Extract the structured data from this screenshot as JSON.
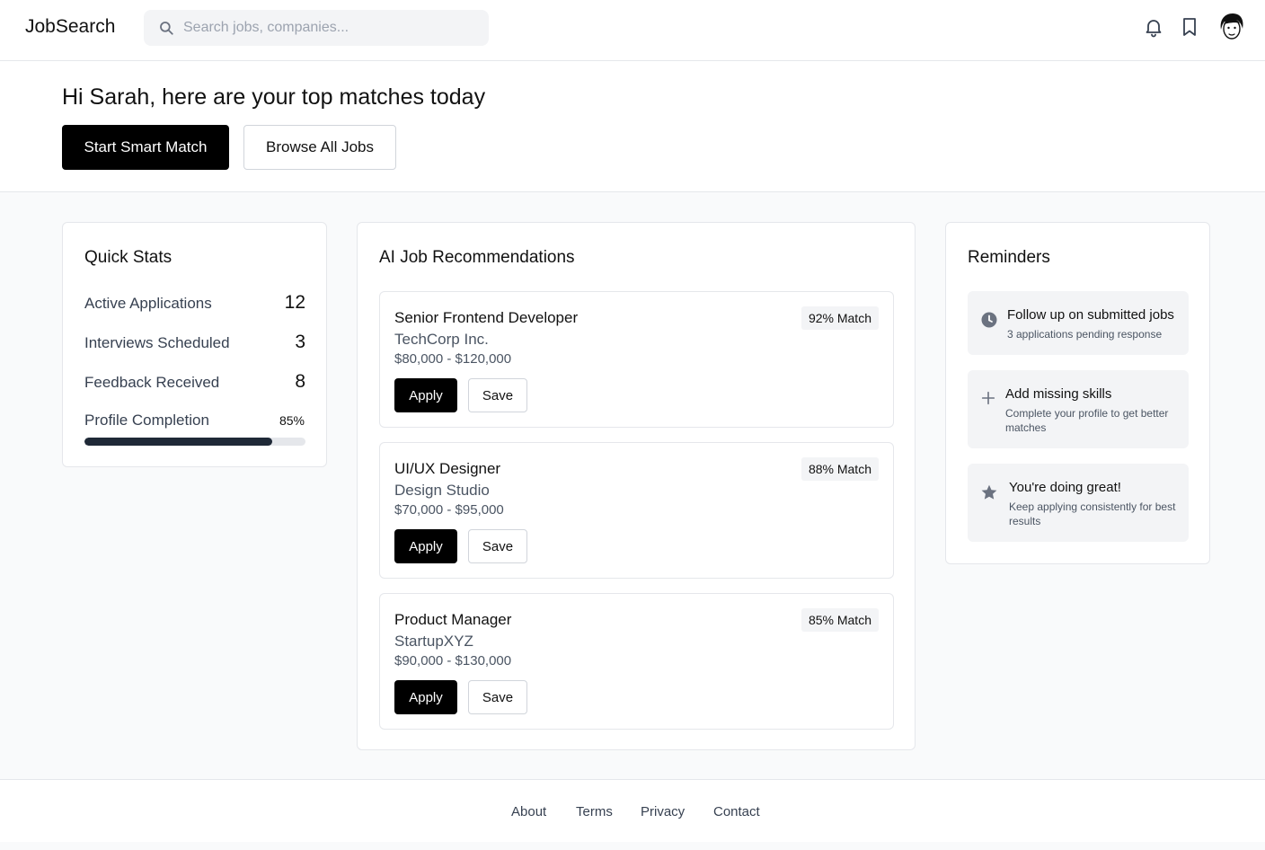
{
  "header": {
    "logo": "JobSearch",
    "search_placeholder": "Search jobs, companies...",
    "icons": [
      "bell-icon",
      "bookmark-icon"
    ]
  },
  "hero": {
    "greeting": "Hi Sarah, here are your top matches today",
    "primary_button": "Start Smart Match",
    "secondary_button": "Browse All Jobs"
  },
  "quick_stats": {
    "title": "Quick Stats",
    "items": [
      {
        "label": "Active Applications",
        "value": "12"
      },
      {
        "label": "Interviews Scheduled",
        "value": "3"
      },
      {
        "label": "Feedback Received",
        "value": "8"
      }
    ],
    "profile_completion_label": "Profile Completion",
    "profile_completion_text": "85%",
    "profile_completion_value": 0.85
  },
  "recommendations": {
    "title": "AI Job Recommendations",
    "apply_label": "Apply",
    "save_label": "Save",
    "jobs": [
      {
        "title": "Senior Frontend Developer",
        "company": "TechCorp Inc.",
        "salary": "$80,000 - $120,000",
        "match": "92% Match"
      },
      {
        "title": "UI/UX Designer",
        "company": "Design Studio",
        "salary": "$70,000 - $95,000",
        "match": "88% Match"
      },
      {
        "title": "Product Manager",
        "company": "StartupXYZ",
        "salary": "$90,000 - $130,000",
        "match": "85% Match"
      }
    ]
  },
  "reminders": {
    "title": "Reminders",
    "items": [
      {
        "icon": "clock-icon",
        "title": "Follow up on submitted jobs",
        "subtitle": "3 applications pending response"
      },
      {
        "icon": "plus-icon",
        "title": "Add missing skills",
        "subtitle": "Complete your profile to get better matches"
      },
      {
        "icon": "star-icon",
        "title": "You're doing great!",
        "subtitle": "Keep applying consistently for best results"
      }
    ]
  },
  "footer": {
    "links": [
      "About",
      "Terms",
      "Privacy",
      "Contact"
    ]
  },
  "colors": {
    "primary": "#000000",
    "progress_fill": "#1f2937",
    "page_bg": "#f9fafb",
    "badge_bg": "#f3f4f6"
  }
}
